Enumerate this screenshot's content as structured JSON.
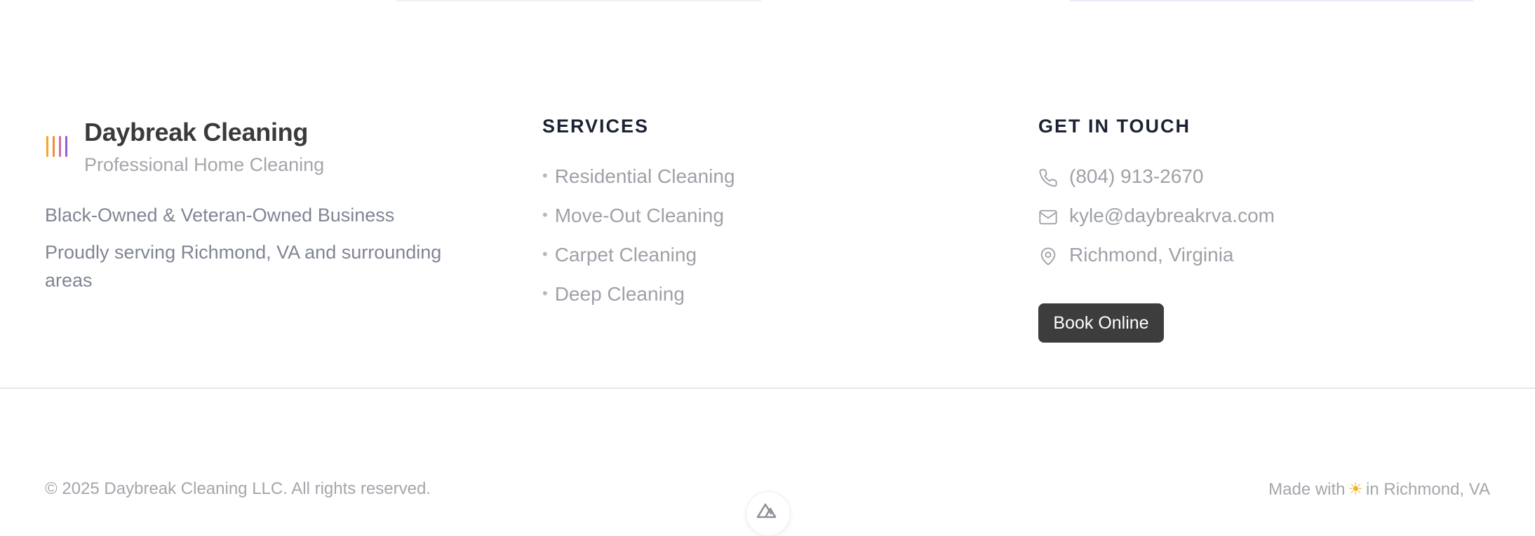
{
  "brand": {
    "name": "Daybreak Cleaning",
    "tagline": "Professional Home Cleaning",
    "mark_colors": [
      "#f5a623",
      "#f28b3c",
      "#d16ba5",
      "#9b59d0"
    ]
  },
  "about": {
    "line1": "Black-Owned & Veteran-Owned Business",
    "line2": "Proudly serving Richmond, VA and surrounding areas"
  },
  "services": {
    "heading": "SERVICES",
    "items": [
      {
        "label": "Residential Cleaning"
      },
      {
        "label": "Move-Out Cleaning"
      },
      {
        "label": "Carpet Cleaning"
      },
      {
        "label": "Deep Cleaning"
      }
    ]
  },
  "contact": {
    "heading": "GET IN TOUCH",
    "phone": {
      "icon": "phone-icon",
      "text": "(804) 913-2670"
    },
    "email": {
      "icon": "mail-icon",
      "text": "kyle@daybreakrva.com"
    },
    "location": {
      "icon": "map-pin-icon",
      "text": "Richmond, Virginia"
    },
    "book_label": "Book Online"
  },
  "footer": {
    "copyright": "© 2025 Daybreak Cleaning LLC. All rights reserved.",
    "made_with_prefix": "Made with",
    "made_with_suffix": "in Richmond, VA",
    "sun_icon": "sun-icon",
    "badge_icon": "nuxt-logo-icon"
  },
  "colors": {
    "accent_dark": "#3d3d3d",
    "heading": "#1c2233",
    "muted": "#9ea1a8"
  }
}
